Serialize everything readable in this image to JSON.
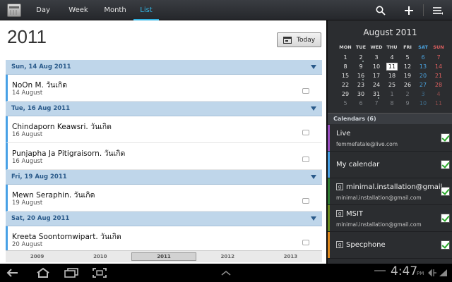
{
  "tabs": [
    {
      "label": "Day"
    },
    {
      "label": "Week"
    },
    {
      "label": "Month"
    },
    {
      "label": "List",
      "active": true
    }
  ],
  "list": {
    "year": "2011",
    "today_label": "Today",
    "groups": [
      {
        "header": "Sun, 14 Aug 2011",
        "events": [
          {
            "name": "NoOn M. วันเกิด",
            "date": "14 August"
          }
        ]
      },
      {
        "header": "Tue, 16 Aug 2011",
        "events": [
          {
            "name": "Chindaporn Keawsri. วันเกิด",
            "date": "16 August"
          },
          {
            "name": "Punjapha Ja Pitigraisorn. วันเกิด",
            "date": "16 August"
          }
        ]
      },
      {
        "header": "Fri, 19 Aug 2011",
        "events": [
          {
            "name": "Mewn Seraphin. วันเกิด",
            "date": "19 August"
          }
        ]
      },
      {
        "header": "Sat, 20 Aug 2011",
        "events": [
          {
            "name": "Kreeta Soontornwipart. วันเกิด",
            "date": "20 August"
          }
        ]
      }
    ],
    "years": [
      "2009",
      "2010",
      "2011",
      "2012",
      "2013"
    ],
    "active_year": "2011"
  },
  "mini_calendar": {
    "title": "August 2011",
    "dow": [
      "MON",
      "TUE",
      "WED",
      "THU",
      "FRI",
      "SAT",
      "SUN"
    ],
    "weeks": [
      [
        "1",
        "2",
        "3",
        "4",
        "5",
        "6",
        "7"
      ],
      [
        "8",
        "9",
        "10",
        "11",
        "12",
        "13",
        "14"
      ],
      [
        "15",
        "16",
        "17",
        "18",
        "19",
        "20",
        "21"
      ],
      [
        "22",
        "23",
        "24",
        "25",
        "26",
        "27",
        "28"
      ],
      [
        "29",
        "30",
        "31",
        "1",
        "2",
        "3",
        "4"
      ],
      [
        "5",
        "6",
        "7",
        "8",
        "9",
        "10",
        "11"
      ]
    ],
    "today": "11"
  },
  "calendars": {
    "header": "Calendars (6)",
    "items": [
      {
        "name": "Live",
        "account": "femmefatale@live.com",
        "color": "#9b4fc4",
        "google": false
      },
      {
        "name": "My calendar",
        "account": "",
        "color": "#48a1e6",
        "google": false
      },
      {
        "name": "minimal.installation@gmail",
        "account": "minimal.installation@gmail.com",
        "color": "#2e7d32",
        "google": true
      },
      {
        "name": "MSIT",
        "account": "minimal.installation@gmail.com",
        "color": "#6a8c1f",
        "google": true
      },
      {
        "name": "Specphone",
        "account": "",
        "color": "#e08a1e",
        "google": true
      }
    ]
  },
  "system": {
    "time": "4:47",
    "ampm": "PM"
  },
  "icons": {
    "search": "search-icon",
    "add": "plus-icon",
    "menu": "menu-icon",
    "back": "back-icon",
    "home": "home-icon",
    "recent": "recent-apps-icon",
    "screenshot": "screenshot-icon"
  }
}
